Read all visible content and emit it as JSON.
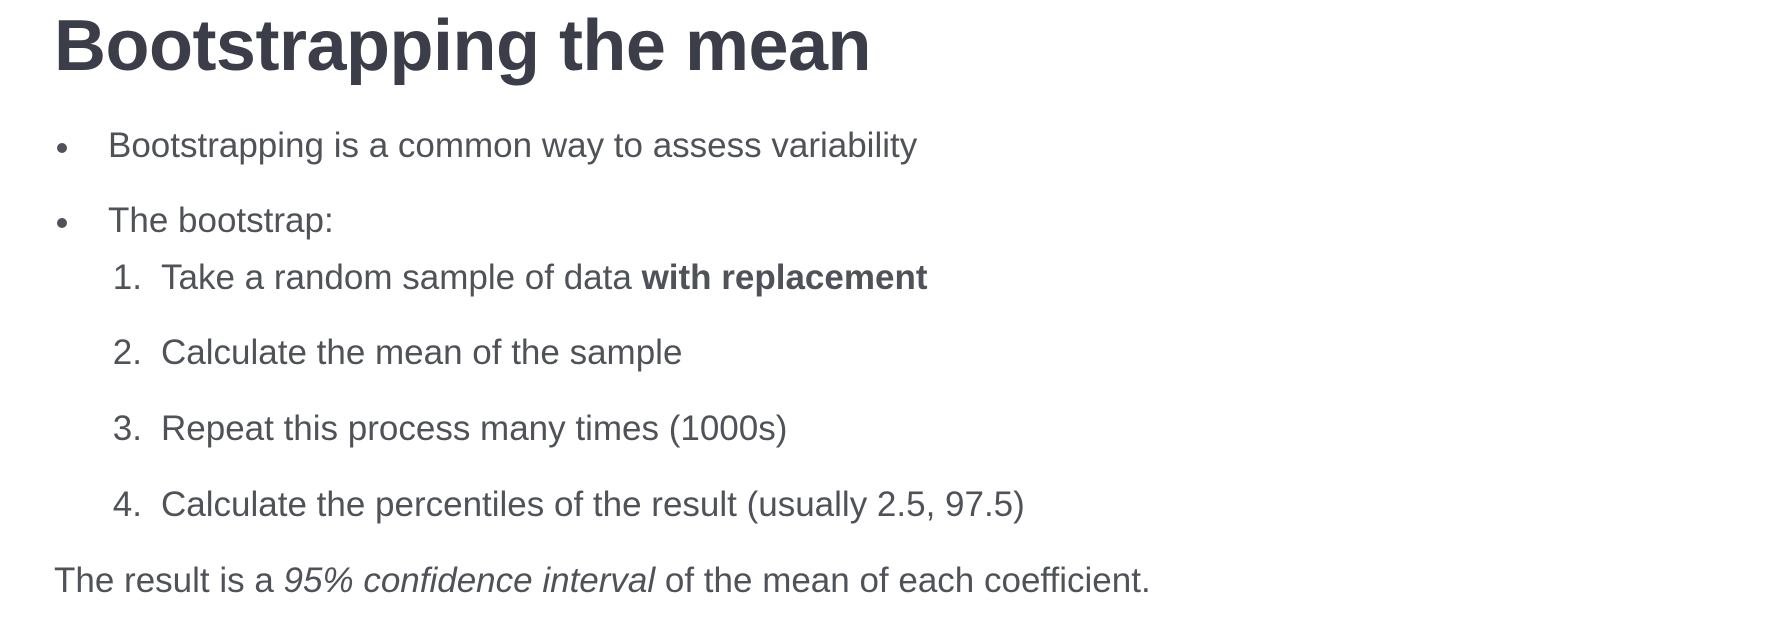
{
  "slide": {
    "title": "Bootstrapping the mean",
    "bullets": [
      {
        "text": "Bootstrapping is a common way to assess variability"
      },
      {
        "text": "The bootstrap:"
      }
    ],
    "steps": [
      {
        "number": "1.",
        "text": "Take a random sample of data ",
        "emphasis": "with replacement"
      },
      {
        "number": "2.",
        "text": "Calculate the mean of the sample"
      },
      {
        "number": "3.",
        "text": "Repeat this process many times (1000s)"
      },
      {
        "number": "4.",
        "text": "Calculate the percentiles of the result (usually 2.5, 97.5)"
      }
    ],
    "conclusion": {
      "before": "The result is a ",
      "italic": "95% confidence interval",
      "after": " of the mean of each coefficient."
    }
  }
}
